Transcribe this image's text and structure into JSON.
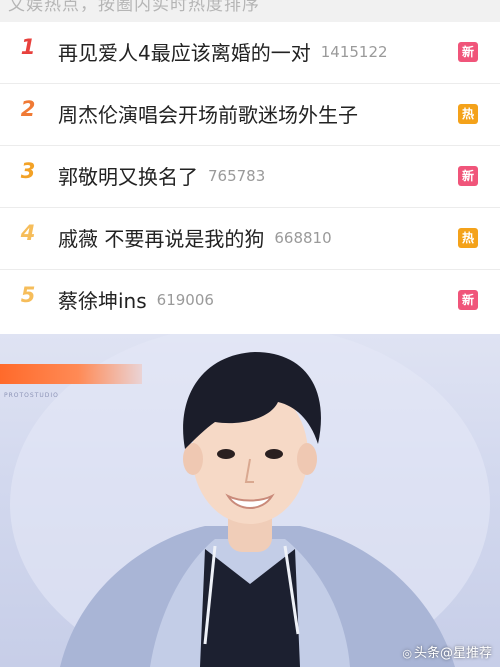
{
  "header": {
    "text": "文娱热点，按圈内实时热度排序"
  },
  "items": [
    {
      "rank": "1",
      "title": "再见爱人4最应该离婚的一对",
      "count": "1415122",
      "badge": "新",
      "badge_color": "#f0557a",
      "rank_color": "#e8413d"
    },
    {
      "rank": "2",
      "title": "周杰伦演唱会开场前歌迷场外生子",
      "count": "",
      "badge": "热",
      "badge_color": "#f4a21a",
      "rank_color": "#f07a35"
    },
    {
      "rank": "3",
      "title": "郭敬明又换名了",
      "count": "765783",
      "badge": "新",
      "badge_color": "#f0557a",
      "rank_color": "#f3a226"
    },
    {
      "rank": "4",
      "title": "戚薇 不要再说是我的狗",
      "count": "668810",
      "badge": "热",
      "badge_color": "#f4a21a",
      "rank_color": "#f6bd5a"
    },
    {
      "rank": "5",
      "title": "蔡徐坤ins",
      "count": "619006",
      "badge": "新",
      "badge_color": "#f0557a",
      "rank_color": "#f6bd5a"
    }
  ],
  "photo": {
    "caption": "PROTOSTUDIO"
  },
  "watermark": {
    "text": "头条@星推荐",
    "icon": "camera-icon"
  }
}
